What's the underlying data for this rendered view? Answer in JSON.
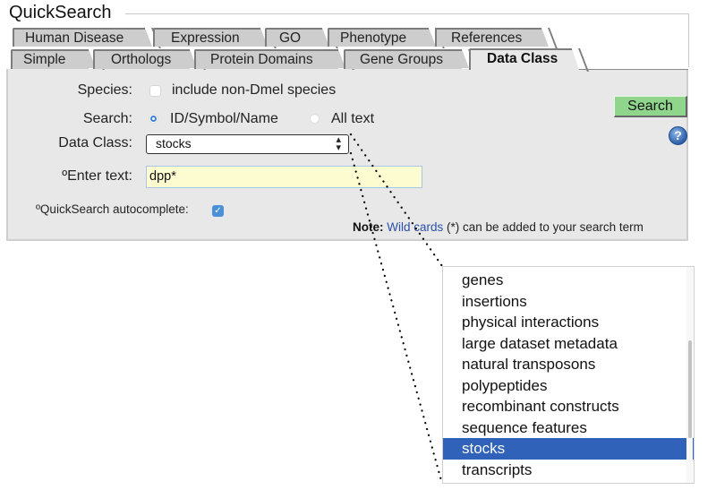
{
  "fieldset_title": "QuickSearch",
  "tabs_row1": [
    {
      "label": "Human Disease"
    },
    {
      "label": "Expression"
    },
    {
      "label": "GO"
    },
    {
      "label": "Phenotype"
    },
    {
      "label": "References"
    }
  ],
  "tabs_row2": [
    {
      "label": "Simple"
    },
    {
      "label": "Orthologs"
    },
    {
      "label": "Protein Domains"
    },
    {
      "label": "Gene Groups"
    },
    {
      "label": "Data Class",
      "active": true
    }
  ],
  "form": {
    "species_label": "Species:",
    "species_checkbox_label": "include non-Dmel species",
    "species_checked": false,
    "search_label": "Search:",
    "search_options": [
      {
        "label": "ID/Symbol/Name",
        "selected": true
      },
      {
        "label": "All text",
        "selected": false
      }
    ],
    "data_class_label": "Data Class:",
    "data_class_value": "stocks",
    "data_class_arrows": "▲▼",
    "enter_text_label": "ºEnter text:",
    "enter_text_value": "dpp*",
    "autocomplete_label": "ºQuickSearch autocomplete:",
    "autocomplete_checked": true,
    "autocomplete_check_glyph": "✓",
    "search_button": "Search",
    "help_icon_glyph": "?",
    "note_prefix": "Note:",
    "note_link": "Wild cards",
    "note_suffix": " (*) can be added to your search term"
  },
  "dropdown": {
    "options": [
      {
        "label": "genes"
      },
      {
        "label": "insertions"
      },
      {
        "label": "physical interactions"
      },
      {
        "label": "large dataset metadata"
      },
      {
        "label": "natural transposons"
      },
      {
        "label": "polypeptides"
      },
      {
        "label": "recombinant constructs"
      },
      {
        "label": "sequence features"
      },
      {
        "label": "stocks",
        "selected": true
      },
      {
        "label": "transcripts"
      }
    ]
  },
  "colors": {
    "panel_bg": "#e8e8e8",
    "tab_bg": "#cdcdcd",
    "search_button_bg": "#8fd68c",
    "input_bg": "#fdfbd0",
    "selection_bg": "#2f62b8",
    "link": "#2b4fa8"
  }
}
